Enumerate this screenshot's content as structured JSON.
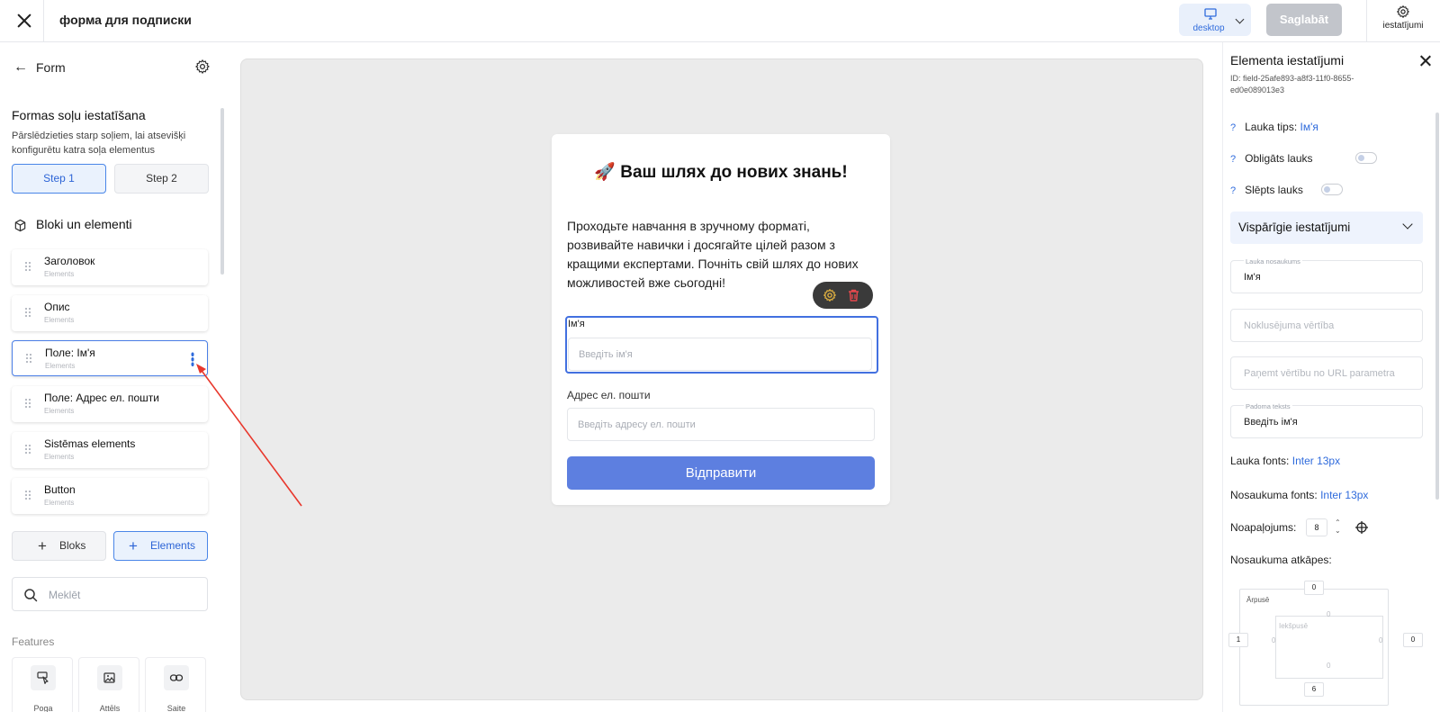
{
  "topbar": {
    "title": "форма для подписки",
    "device_label": "desktop",
    "save_label": "Saglabāt",
    "settings_label": "iestatījumi"
  },
  "left_panel": {
    "title": "Form",
    "steps_heading": "Formas soļu iestatīšana",
    "steps_description": "Pārslēdzieties starp soļiem, lai atsevišķi konfigurētu katra soļa elementus",
    "steps": [
      "Step 1",
      "Step 2"
    ],
    "active_step": "Step 1",
    "blocks_heading": "Bloki un elementi",
    "elements": [
      {
        "name": "Заголовок",
        "type": "Elements"
      },
      {
        "name": "Опис",
        "type": "Elements"
      },
      {
        "name": "Поле: Ім'я",
        "type": "Elements"
      },
      {
        "name": "Поле: Адрес ел. пошти",
        "type": "Elements"
      },
      {
        "name": "Sistēmas elements",
        "type": "Elements"
      },
      {
        "name": "Button",
        "type": "Elements"
      }
    ],
    "add_blocks_label": "Bloks",
    "add_elements_label": "Elements",
    "search_placeholder": "Meklēt",
    "features_heading": "Features",
    "features": [
      "Poga",
      "Attēls",
      "Saite"
    ]
  },
  "form_card": {
    "title": "🚀 Ваш шлях до нових знань!",
    "description": "Проходьте навчання в зручному форматі, розвивайте навички і досягайте цілей разом з кращими експертами. Почніть свій шлях до нових можливостей вже сьогодні!",
    "name_label": "Ім'я",
    "name_placeholder": "Введіть ім'я",
    "email_label": "Адрес ел. пошти",
    "email_placeholder": "Введіть адресу ел. пошти",
    "submit_label": "Відправити"
  },
  "right_panel": {
    "title": "Elementa iestatījumi",
    "element_id": "ID: field-25afe893-a8f3-11f0-8655-ed0e089013e3",
    "field_type_label": "Lauka tips:",
    "field_type_value": "Ім'я",
    "required_label": "Obligāts lauks",
    "hidden_label": "Slēpts lauks",
    "general_section": "Vispārīgie iestatījumi",
    "field_name_label": "Lauka nosaukums",
    "field_name_value": "Ім'я",
    "default_value_placeholder": "Noklusējuma vērtība",
    "url_param_placeholder": "Paņemt vērtību no URL parametra",
    "hint_label": "Padoma teksts",
    "hint_value": "Введіть ім'я",
    "field_font_label": "Lauka fonts:",
    "field_font_value": "Inter 13px",
    "name_font_label": "Nosaukuma fonts:",
    "name_font_value": "Inter 13px",
    "rounding_label": "Noapaļojums:",
    "rounding_value": "8",
    "spacing_label": "Nosaukuma atkāpes:",
    "outer_label": "Ārpusē",
    "inner_label": "Iekšpusē",
    "outer": {
      "top": "0",
      "left": "1",
      "right": "0",
      "bottom": "6"
    },
    "inner": {
      "top": "0",
      "left": "0",
      "right": "0",
      "bottom": "0"
    }
  }
}
